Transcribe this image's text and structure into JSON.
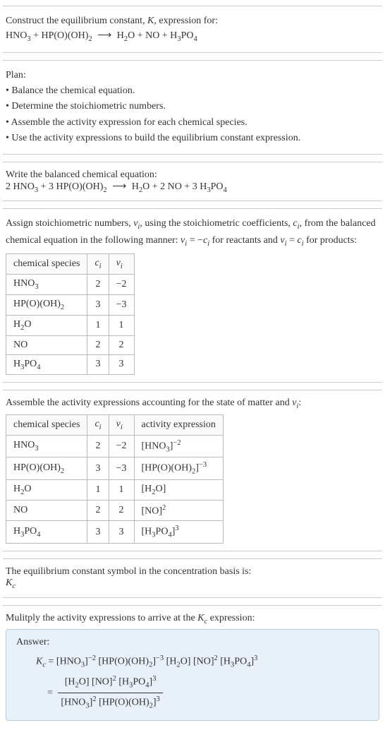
{
  "prompt": {
    "line1": "Construct the equilibrium constant, ",
    "Kvar": "K",
    "line1_cont": ", expression for:",
    "eq_lhs_1": "HNO",
    "eq_lhs_1_sub": "3",
    "eq_plus1": " + HP(O)(OH)",
    "eq_lhs_2_sub": "2",
    "arrow": "⟶",
    "eq_rhs_1": "H",
    "eq_rhs_1_sub": "2",
    "eq_rhs_1b": "O + NO + H",
    "eq_rhs_2_sub": "3",
    "eq_rhs_2b": "PO",
    "eq_rhs_3_sub": "4"
  },
  "plan": {
    "title": "Plan:",
    "b1": "• Balance the chemical equation.",
    "b2": "• Determine the stoichiometric numbers.",
    "b3": "• Assemble the activity expression for each chemical species.",
    "b4": "• Use the activity expressions to build the equilibrium constant expression."
  },
  "balanced": {
    "title": "Write the balanced chemical equation:",
    "c1": "2 HNO",
    "c1s": "3",
    "c2": " + 3 HP(O)(OH)",
    "c2s": "2",
    "arrow": "⟶",
    "c3": "H",
    "c3s": "2",
    "c3b": "O + 2 NO + 3 H",
    "c4s": "3",
    "c4b": "PO",
    "c5s": "4"
  },
  "stoich": {
    "intro1": "Assign stoichiometric numbers, ",
    "nu": "ν",
    "sub_i": "i",
    "intro2": ", using the stoichiometric coefficients, ",
    "c": "c",
    "intro3": ", from the balanced chemical equation in the following manner: ",
    "eq1a": "ν",
    "eq1b": " = −",
    "eq1c": "c",
    "intro4": " for reactants and ",
    "eq2a": "ν",
    "eq2b": " = ",
    "eq2c": "c",
    "intro5": " for products:",
    "headers": {
      "h1": "chemical species",
      "h2": "c",
      "h2sub": "i",
      "h3": "ν",
      "h3sub": "i"
    },
    "rows": [
      {
        "sp": "HNO",
        "sp_sub": "3",
        "c": "2",
        "nu": "−2"
      },
      {
        "sp": "HP(O)(OH)",
        "sp_sub": "2",
        "c": "3",
        "nu": "−3"
      },
      {
        "sp": "H",
        "sp_sub": "2",
        "sp_tail": "O",
        "c": "1",
        "nu": "1"
      },
      {
        "sp": "NO",
        "sp_sub": "",
        "c": "2",
        "nu": "2"
      },
      {
        "sp": "H",
        "sp_sub": "3",
        "sp_tail": "PO",
        "sp_sub2": "4",
        "c": "3",
        "nu": "3"
      }
    ]
  },
  "activity": {
    "intro1": "Assemble the activity expressions accounting for the state of matter and ",
    "nu": "ν",
    "sub_i": "i",
    "intro2": ":",
    "headers": {
      "h1": "chemical species",
      "h2": "c",
      "h2sub": "i",
      "h3": "ν",
      "h3sub": "i",
      "h4": "activity expression"
    },
    "rows": [
      {
        "sp": "HNO",
        "sp_sub": "3",
        "c": "2",
        "nu": "−2",
        "ae_pre": "[HNO",
        "ae_sub": "3",
        "ae_post": "]",
        "ae_sup": "−2"
      },
      {
        "sp": "HP(O)(OH)",
        "sp_sub": "2",
        "c": "3",
        "nu": "−3",
        "ae_pre": "[HP(O)(OH)",
        "ae_sub": "2",
        "ae_post": "]",
        "ae_sup": "−3"
      },
      {
        "sp": "H",
        "sp_sub": "2",
        "sp_tail": "O",
        "c": "1",
        "nu": "1",
        "ae_pre": "[H",
        "ae_sub": "2",
        "ae_post": "O]",
        "ae_sup": ""
      },
      {
        "sp": "NO",
        "sp_sub": "",
        "c": "2",
        "nu": "2",
        "ae_pre": "[NO]",
        "ae_sub": "",
        "ae_post": "",
        "ae_sup": "2"
      },
      {
        "sp": "H",
        "sp_sub": "3",
        "sp_tail": "PO",
        "sp_sub2": "4",
        "c": "3",
        "nu": "3",
        "ae_pre": "[H",
        "ae_sub": "3",
        "ae_post_a": "PO",
        "ae_sub2": "4",
        "ae_post": "]",
        "ae_sup": "3"
      }
    ]
  },
  "kcdef": {
    "line1": "The equilibrium constant symbol in the concentration basis is:",
    "K": "K",
    "sub": "c"
  },
  "multiply": {
    "line1a": "Mulitply the activity expressions to arrive at the ",
    "K": "K",
    "sub": "c",
    "line1b": " expression:"
  },
  "answer": {
    "title": "Answer:",
    "Kc_K": "K",
    "Kc_sub": "c",
    "eq": " = ",
    "t1": "[HNO",
    "t1s": "3",
    "t1p": "]",
    "t1e": "−2",
    "t2": " [HP(O)(OH)",
    "t2s": "2",
    "t2p": "]",
    "t2e": "−3",
    "t3": " [H",
    "t3s": "2",
    "t3p": "O] [NO]",
    "t3e": "2",
    "t4": " [H",
    "t4s": "3",
    "t4pa": "PO",
    "t4s2": "4",
    "t4p": "]",
    "t4e": "3",
    "eq2": "= ",
    "num1": "[H",
    "num1s": "2",
    "num1p": "O] [NO]",
    "num1e": "2",
    "num2": " [H",
    "num2s": "3",
    "num2pa": "PO",
    "num2s2": "4",
    "num2p": "]",
    "num2e": "3",
    "den1": "[HNO",
    "den1s": "3",
    "den1p": "]",
    "den1e": "2",
    "den2": " [HP(O)(OH)",
    "den2s": "2",
    "den2p": "]",
    "den2e": "3"
  }
}
